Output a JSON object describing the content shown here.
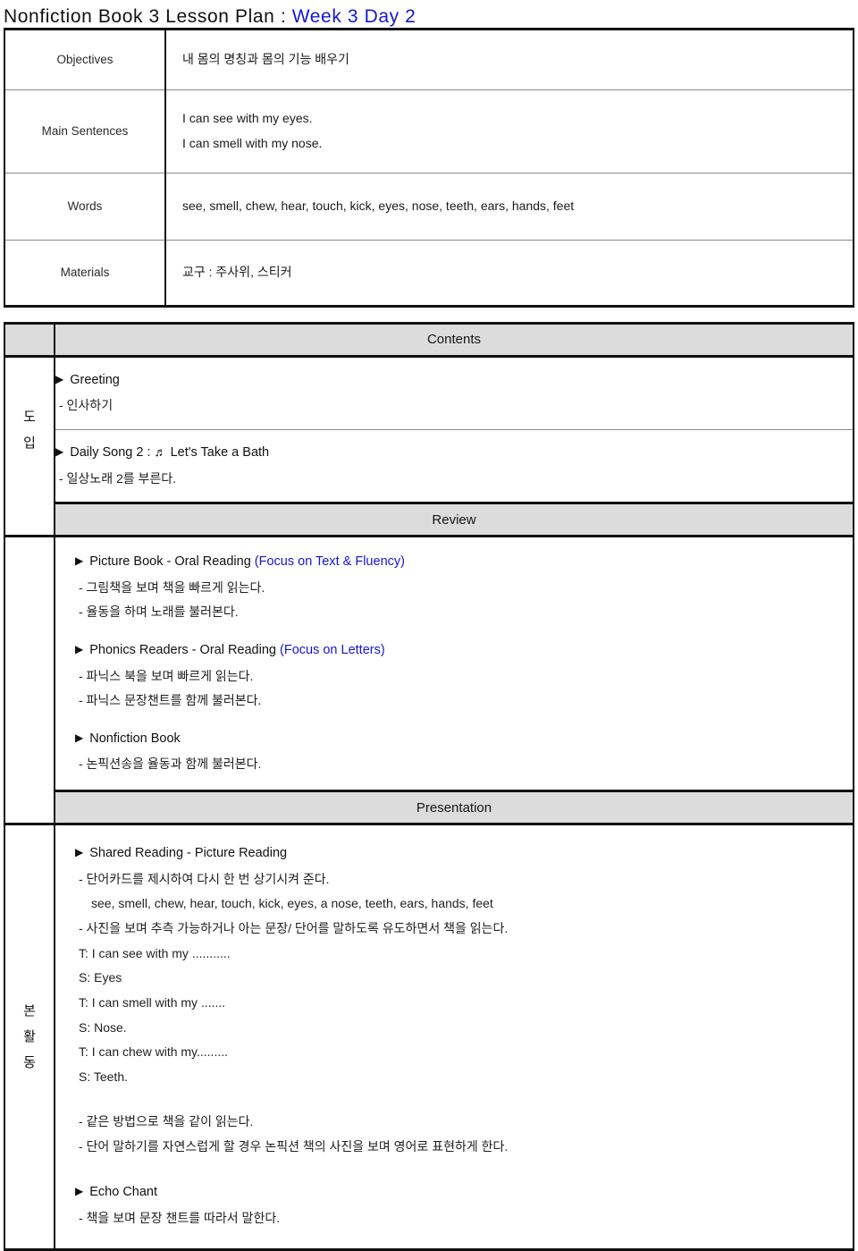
{
  "title": {
    "main": "Nonfiction Book 3 Lesson Plan : ",
    "accent": "Week 3   Day 2"
  },
  "info_table": {
    "rows": [
      {
        "label": "Objectives",
        "lines": [
          "내 몸의 명칭과 몸의 기능 배우기"
        ]
      },
      {
        "label": "Main Sentences",
        "lines": [
          "I can see with my eyes.",
          "I can smell with my nose."
        ]
      },
      {
        "label": "Words",
        "lines": [
          "see, smell, chew, hear, touch, kick, eyes, nose, teeth, ears, hands, feet"
        ]
      },
      {
        "label": "Materials",
        "lines": [
          "교구 : 주사위, 스티커"
        ]
      }
    ]
  },
  "plan": {
    "contents_banner": "Contents",
    "stage_intro": [
      "도",
      "입"
    ],
    "stage_main": [
      "본",
      "활",
      "동"
    ],
    "intro": {
      "block1": {
        "heading": "Greeting",
        "lines": [
          "- 인사하기"
        ]
      },
      "block2": {
        "heading_prefix": "Daily Song 2 : ",
        "note_glyph": "♬",
        "heading_suffix": " Let's Take a Bath",
        "lines": [
          "- 일상노래 2를 부른다."
        ]
      }
    },
    "review": {
      "banner": "Review",
      "blocks": [
        {
          "heading": "Picture Book - Oral Reading ",
          "heading_blue": "(Focus on Text & Fluency)",
          "lines": [
            "- 그림책을 보며 책을 빠르게 읽는다.",
            "- 율동을 하며 노래를 불러본다."
          ]
        },
        {
          "heading": "Phonics Readers - Oral Reading ",
          "heading_blue": "(Focus on Letters)",
          "lines": [
            "- 파닉스 북을 보며 빠르게 읽는다.",
            "- 파닉스 문장챈트를 함께 불러본다."
          ]
        },
        {
          "heading": "Nonfiction Book",
          "heading_blue": "",
          "lines": [
            "- 논픽션송을 율동과 함께 불러본다."
          ]
        }
      ]
    },
    "presentation": {
      "banner": "Presentation",
      "block1": {
        "heading": "Shared Reading - Picture Reading",
        "lines": [
          "- 단어카드를 제시하여 다시 한 번 상기시켜 준다.",
          "see, smell, chew, hear, touch, kick, eyes, a nose, teeth, ears, hands, feet",
          "- 사진을 보며 추측 가능하거나 아는 문장/ 단어를 말하도록 유도하면서 책을 읽는다.",
          "T: I can see with my ...........",
          "S: Eyes",
          "T: I can smell with my .......",
          "S: Nose.",
          "T: I can chew with my.........",
          "S: Teeth."
        ],
        "lines_after": [
          "- 같은 방법으로 책을 같이 읽는다.",
          "- 단어 말하기를 자연스럽게 할 경우 논픽션 책의 사진을 보며 영어로 표현하게 한다."
        ]
      },
      "block2": {
        "heading": "Echo Chant",
        "lines": [
          "- 책을 보며 문장 챈트를 따라서 말한다."
        ]
      }
    }
  },
  "colors": {
    "accent_blue": "#1616cf",
    "banner_grey": "#dcdcdc",
    "border_dark": "#111111",
    "border_light": "#8a8a8a"
  }
}
